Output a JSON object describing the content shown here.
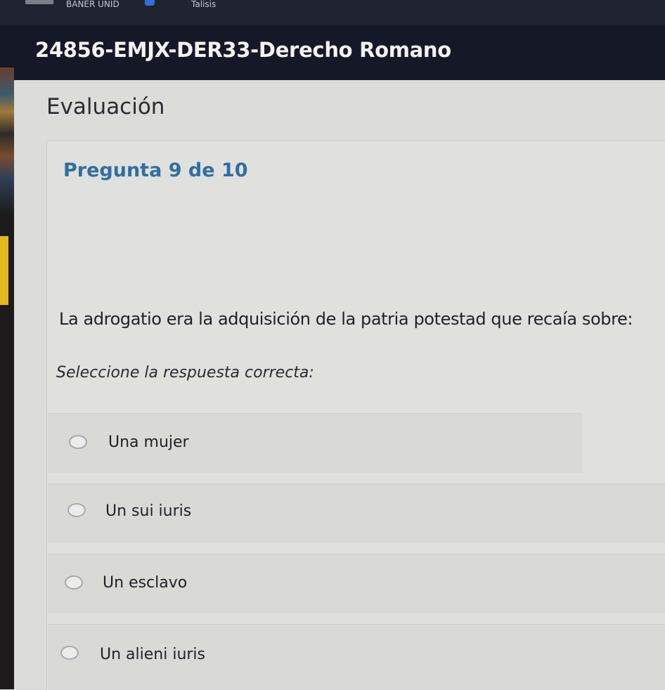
{
  "browser": {
    "bookmarks": [
      {
        "label": "BANER UNID"
      },
      {
        "label": "Talisis"
      }
    ]
  },
  "course": {
    "title": "24856-EMJX-DER33-Derecho Romano"
  },
  "assessment": {
    "section_title": "Evaluación",
    "question_counter": "Pregunta 9 de 10",
    "question_text": "La adrogatio era la adquisición de la patria potestad que recaía sobre:",
    "instruction": "Seleccione la respuesta correcta:",
    "options": [
      {
        "label": "Una mujer",
        "selected": false
      },
      {
        "label": "Un sui iuris",
        "selected": false
      },
      {
        "label": "Un esclavo",
        "selected": false
      },
      {
        "label": "Un alieni iuris",
        "selected": false
      }
    ]
  },
  "colors": {
    "header_bg": "#151826",
    "question_counter": "#2f6ea3",
    "accent_yellow": "#e2b820"
  }
}
